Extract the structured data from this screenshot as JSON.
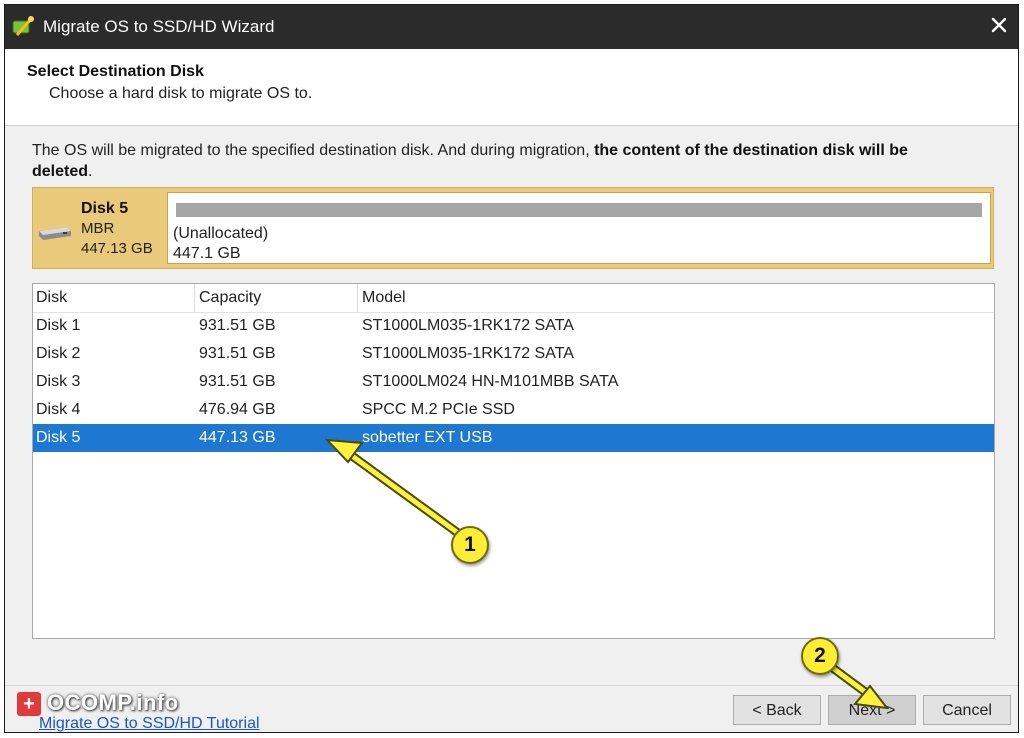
{
  "window": {
    "title": "Migrate OS to SSD/HD Wizard",
    "close_symbol": "✕"
  },
  "header": {
    "title": "Select Destination Disk",
    "subtitle": "Choose a hard disk to migrate OS to."
  },
  "notice": {
    "text_before": "The OS will be migrated to the specified destination disk. And during migration, ",
    "text_bold": "the content of the destination disk will be deleted",
    "text_after": "."
  },
  "selected_disk": {
    "name": "Disk 5",
    "type": "MBR",
    "size": "447.13 GB",
    "partition_label": "(Unallocated)",
    "partition_size": "447.1 GB"
  },
  "table": {
    "columns": [
      "Disk",
      "Capacity",
      "Model"
    ],
    "rows": [
      {
        "disk": "Disk 1",
        "capacity": "931.51 GB",
        "model": "ST1000LM035-1RK172 SATA",
        "selected": false
      },
      {
        "disk": "Disk 2",
        "capacity": "931.51 GB",
        "model": "ST1000LM035-1RK172 SATA",
        "selected": false
      },
      {
        "disk": "Disk 3",
        "capacity": "931.51 GB",
        "model": "ST1000LM024 HN-M101MBB SATA",
        "selected": false
      },
      {
        "disk": "Disk 4",
        "capacity": "476.94 GB",
        "model": "SPCC M.2 PCIe SSD",
        "selected": false
      },
      {
        "disk": "Disk 5",
        "capacity": "447.13 GB",
        "model": "sobetter EXT USB",
        "selected": true
      }
    ]
  },
  "footer": {
    "tutorial_link": "Migrate OS to SSD/HD Tutorial",
    "back_label": "< Back",
    "next_label": "Next >",
    "cancel_label": "Cancel"
  },
  "watermark": {
    "icon": "+",
    "text": "OCOMP.info"
  },
  "annotations": {
    "marker_1": "1",
    "marker_2": "2"
  },
  "colors": {
    "selection": "#1e78d2",
    "disk_card": "#e9c97a",
    "marker": "#ffee33",
    "titlebar": "#2b2b2b"
  }
}
